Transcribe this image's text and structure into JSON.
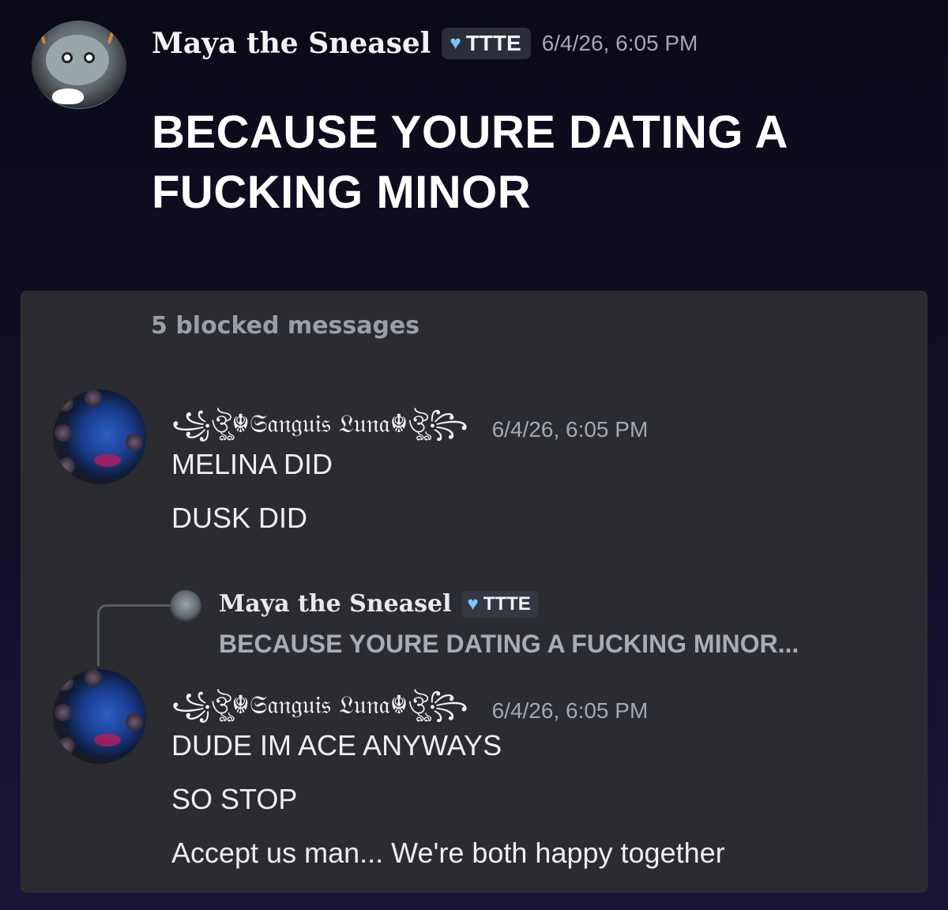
{
  "top_message": {
    "author": "Maya the Sneasel",
    "tag": "TTTE",
    "tag_icon": "heart-icon",
    "timestamp": "6/4/26, 6:05 PM",
    "text": "BECAUSE YOURE DATING A FUCKING MINOR"
  },
  "blocked": {
    "label": "5 blocked messages",
    "messages": [
      {
        "author": "꧁ঔৣ☬𝔖𝔞𝔫𝔤𝔲𝔦𝔰 𝔏𝔲𝔫𝔞☬ঔৣ꧂",
        "timestamp": "6/4/26, 6:05 PM",
        "lines": [
          "MELINA DID",
          "DUSK DID"
        ]
      },
      {
        "author": "꧁ঔৣ☬𝔖𝔞𝔫𝔤𝔲𝔦𝔰 𝔏𝔲𝔫𝔞☬ঔৣ꧂",
        "timestamp": "6/4/26, 6:05 PM",
        "reply": {
          "author": "Maya the Sneasel",
          "tag": "TTTE",
          "text": "BECAUSE YOURE DATING A FUCKING MINOR..."
        },
        "lines": [
          "DUDE IM ACE ANYWAYS",
          "SO STOP",
          "Accept us man... We're both happy together"
        ]
      }
    ]
  },
  "colors": {
    "background": "#0b0a18",
    "panel": "#2b2c31",
    "tag_heart": "#7cc6ff",
    "muted_text": "#9b9ea6"
  }
}
